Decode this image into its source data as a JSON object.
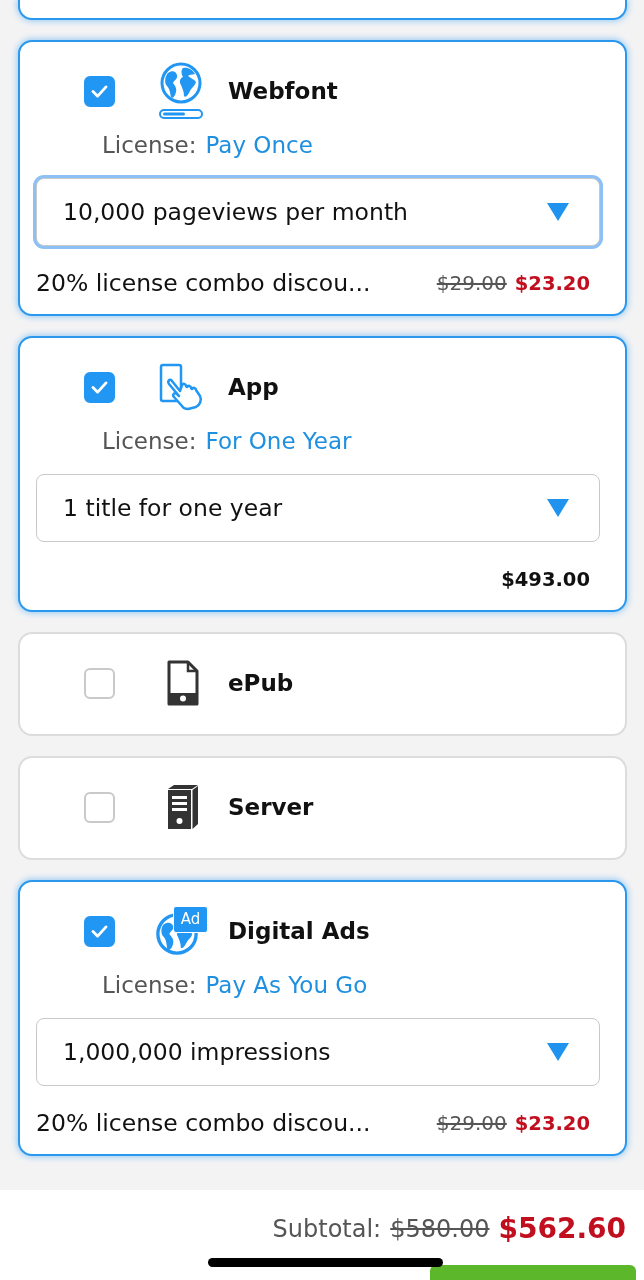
{
  "partial_card": {
    "selected": true
  },
  "licenses": [
    {
      "kind": "webfont",
      "name": "Webfont",
      "checked": true,
      "license_label": "License:",
      "license_type": "Pay Once",
      "option": {
        "value": "10,000 pageviews per month",
        "focused": true
      },
      "discount": "20% license combo discou...",
      "original_price": "$29.00",
      "price": "$23.20"
    },
    {
      "kind": "app",
      "name": "App",
      "checked": true,
      "license_label": "License:",
      "license_type": "For One Year",
      "option": {
        "value": "1 title for one year",
        "focused": false
      },
      "price": "$493.00"
    },
    {
      "kind": "epub",
      "name": "ePub",
      "checked": false
    },
    {
      "kind": "server",
      "name": "Server",
      "checked": false
    },
    {
      "kind": "ads",
      "name": "Digital Ads",
      "checked": true,
      "icon_badge": "Ad",
      "license_label": "License:",
      "license_type": "Pay As You Go",
      "option": {
        "value": "1,000,000 impressions",
        "focused": false
      },
      "discount": "20% license combo discou...",
      "original_price": "$29.00",
      "price": "$23.20"
    }
  ],
  "subtotal": {
    "label": "Subtotal:",
    "original": "$580.00",
    "total": "$562.60"
  }
}
